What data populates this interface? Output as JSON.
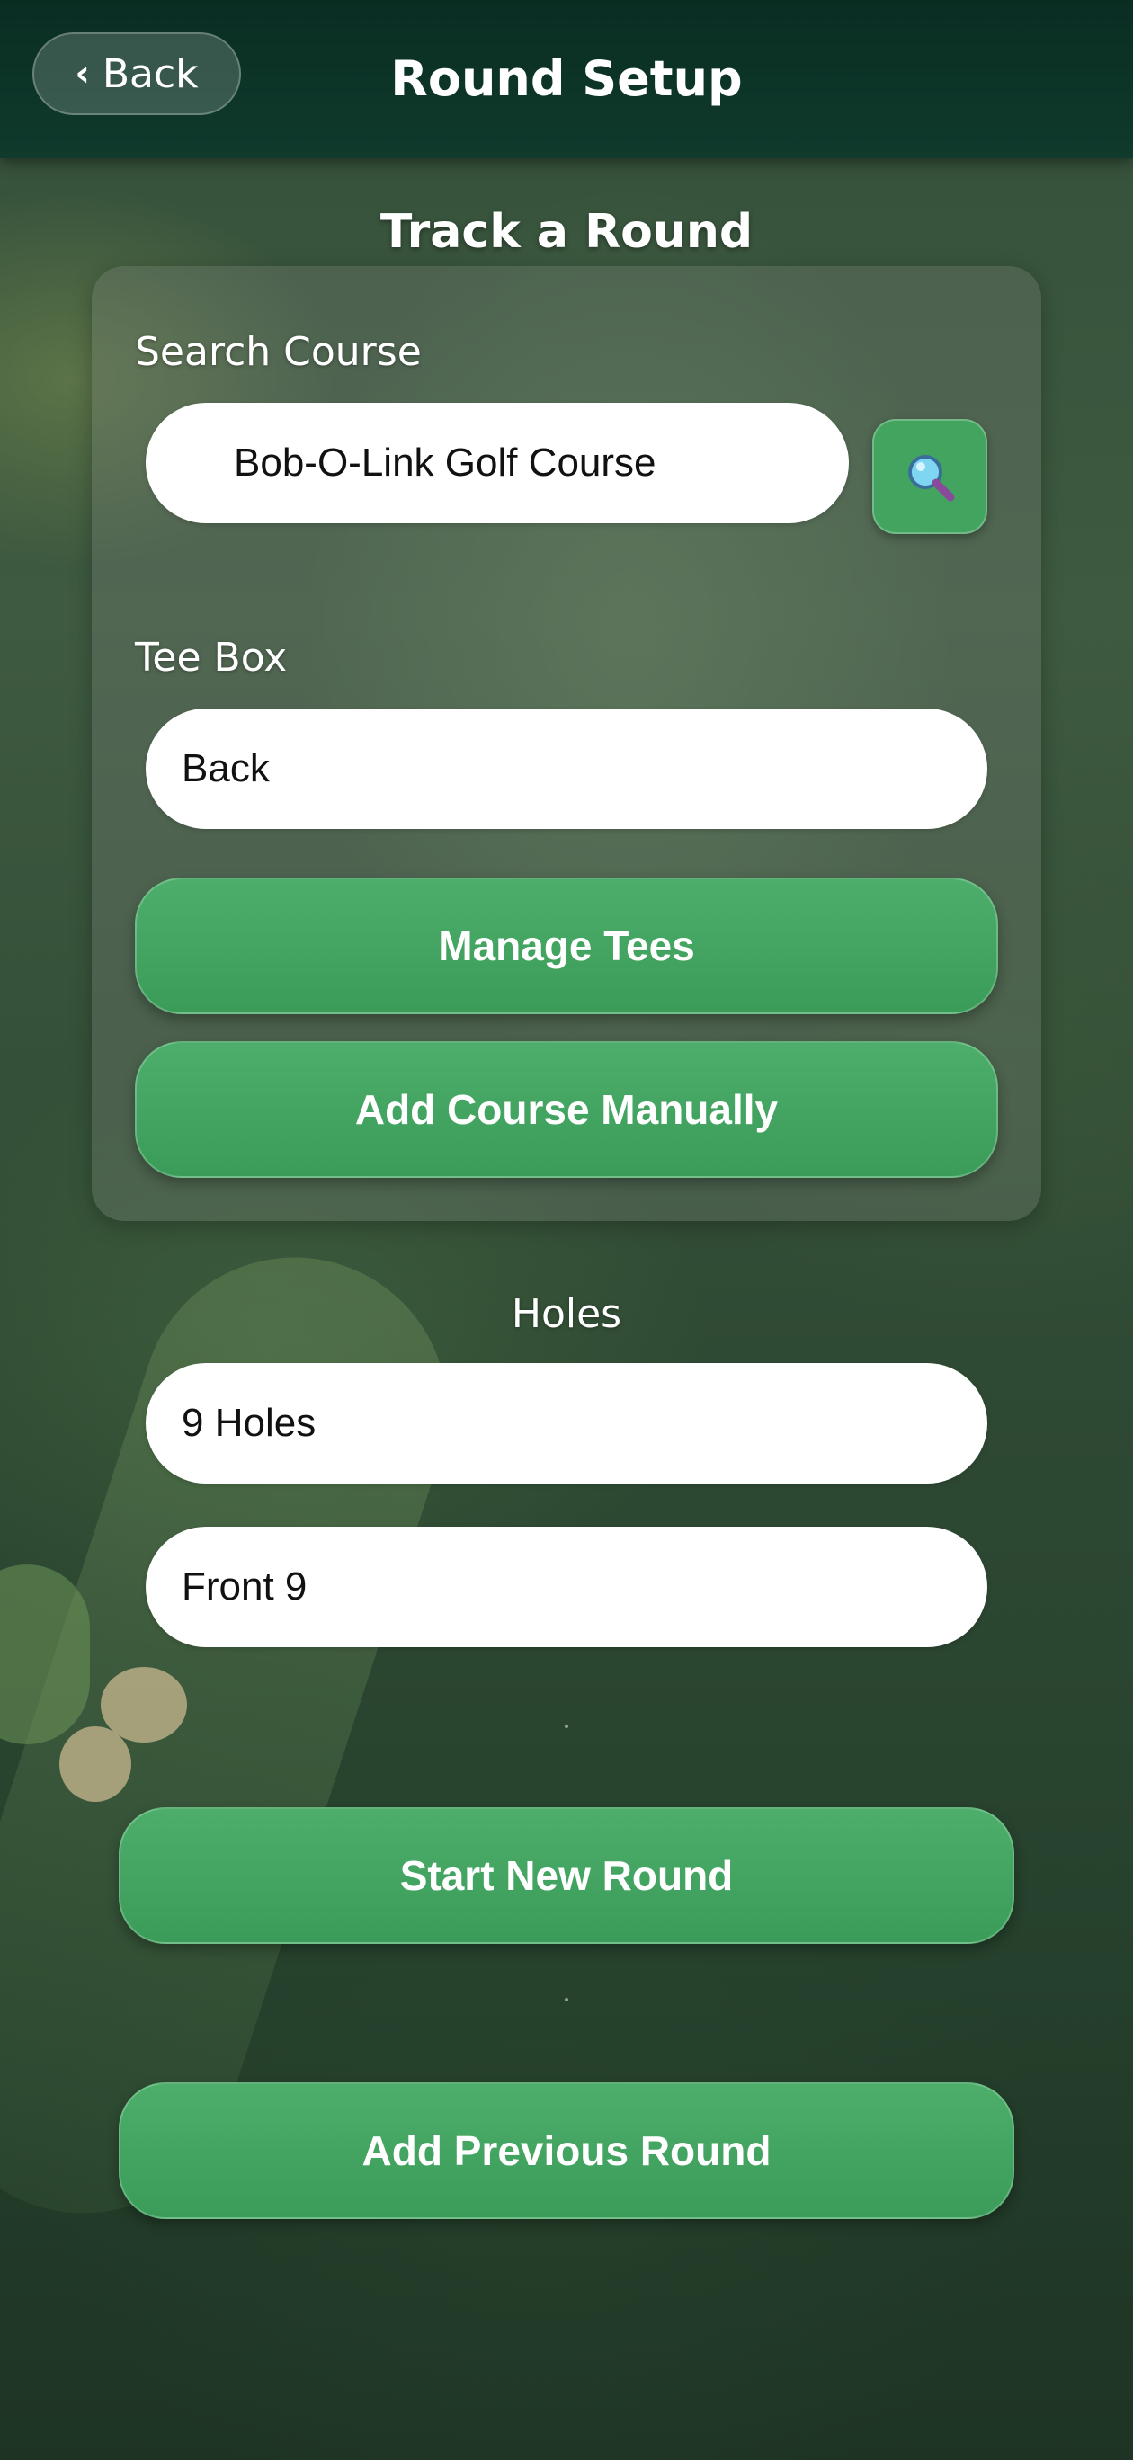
{
  "header": {
    "back_label": "Back",
    "title": "Round Setup"
  },
  "section_title": "Track a Round",
  "search": {
    "label": "Search Course",
    "value": "Bob-O-Link Golf Course"
  },
  "tee_box": {
    "label": "Tee Box",
    "value": "Back"
  },
  "buttons": {
    "manage_tees": "Manage Tees",
    "add_course_manually": "Add Course Manually",
    "start_new_round": "Start New Round",
    "add_previous_round": "Add Previous Round"
  },
  "holes": {
    "label": "Holes",
    "count_value": "9 Holes",
    "segment_value": "Front 9"
  },
  "colors": {
    "header_bg": "#0a2d22",
    "button_green": "#43a460",
    "input_bg": "#ffffff"
  },
  "icons": {
    "back": "chevron-left-icon",
    "search": "magnifying-glass-icon"
  }
}
